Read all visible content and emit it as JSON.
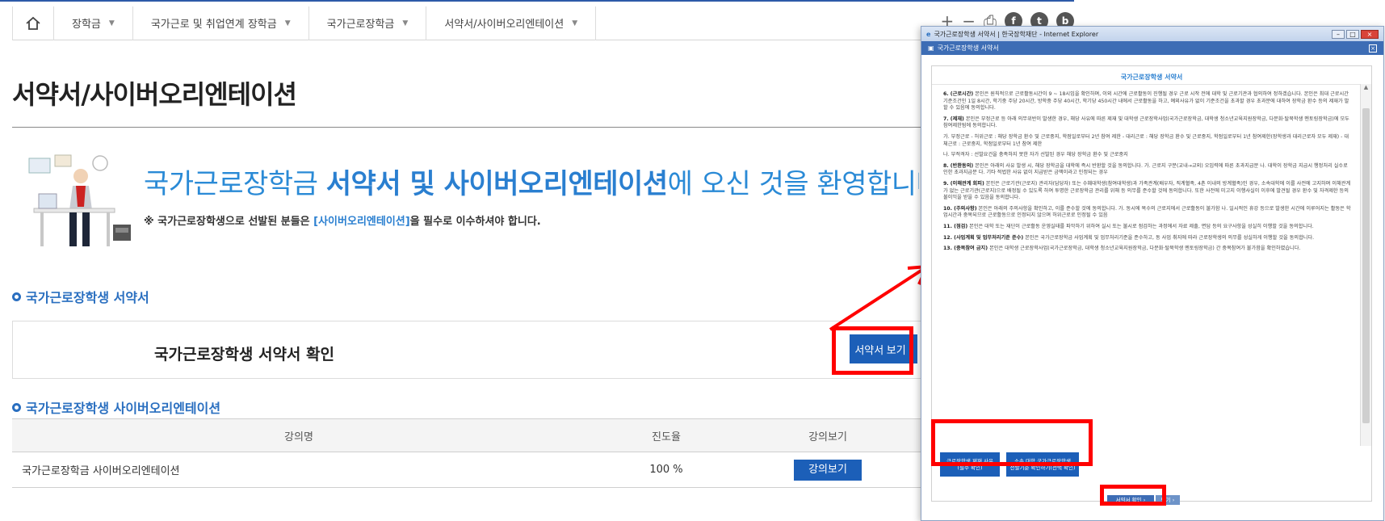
{
  "nav": {
    "items": [
      {
        "label": "장학금"
      },
      {
        "label": "국가근로 및 취업연계 장학금"
      },
      {
        "label": "국가근로장학금"
      },
      {
        "label": "서약서/사이버오리엔테이션"
      }
    ],
    "tools": {
      "plus": "+",
      "minus": "−",
      "print": "⎙",
      "facebook": "f",
      "twitter": "t",
      "blog": "b"
    }
  },
  "page": {
    "title": "서약서/사이버오리엔테이션"
  },
  "welcome": {
    "prefix": "국가근로장학금 ",
    "bold": "서약서 및 사이버오리엔테이션",
    "suffix": "에 오신 것을 환영합니다",
    "notice_prefix": "※ 국가근로장학생으로 선발된 분들은 ",
    "notice_link": "[사이버오리엔테이션]",
    "notice_suffix": "을 필수로 이수하셔야 합니다."
  },
  "oath": {
    "section_title": "국가근로장학생 서약서",
    "label": "국가근로장학생 서약서 확인",
    "button": "서약서 보기 ›"
  },
  "orientation": {
    "section_title": "국가근로장학생 사이버오리엔테이션",
    "headers": [
      "강의명",
      "진도율",
      "강의보기"
    ],
    "rows": [
      {
        "name": "국가근로장학금 사이버오리엔테이션",
        "progress": "100 %",
        "button": "강의보기"
      }
    ]
  },
  "popup": {
    "window_title": "국가근로장학생 서약서 | 한국장학재단 - Internet Explorer",
    "header": "국가근로장학생 서약서",
    "doc_title": "국가근로장학생 서약서",
    "clauses": [
      {
        "head": "6. (근로시간)",
        "body": "본인은 원칙적으로 근로활동시간이 9 ~ 18시임을 확인하며, 이외 시간에 근로활동이 진행될 경우 근로 시작 전에 대학 및 근로기관과 협의하여 정하겠습니다. 본인은 최대 근로시간 기준조건인 1일 8시간, 학기중 주당 20시간, 방학중 주당 40시간, 학기당 450시간 내에서 근로활동을 하고, 예외사유가 없이 기준조건을 초과할 경우 초과분에 대하여 장학금 환수 등의 제재가 발할 수 있음에 동의합니다."
      },
      {
        "head": "7. (제재)",
        "body": "본인은 부정근로 등 아래 의무위반이 발생한 경우, 해당 사유에 따른 제재 및 대학생 근로장학사업(국가근로장학금, 대학생 청소년교육지원장학금, 다문화·탈북학생 멘토링장학금)에 모두 참여제한됨에 동의합니다."
      },
      {
        "head": "",
        "body": "가. 부정근로 - 허위근로 : 해당 장학금 환수 및 근로중지, 학점일로부터 2년 참여 제한 - 대리근로 : 해당 장학금 환수 및 근로중지, 학점일로부터 1년 참여제한(장학생과 대리근로자 모두 제재) - 대체근로 : 근로중지, 학점일로부터 1년 참여 제한"
      },
      {
        "head": "",
        "body": "나. 부적격자 : 선발요건을 충족하지 못한 자가 선발된 경우 해당 장학금 환수 및 근로중지"
      },
      {
        "head": "8. (반환동의)",
        "body": "본인은 아래의 사유 발생 시, 해당 장학금을 대학에 즉시 반환할 것을 동의합니다. 가. 근로지 구분(교내→교외) 오입력에 따른 초과지급분 나. 대학이 장학금 지급시 행정처리 실수로 인한 초과지급분 다. 기타 적법한 사유 없이 지급받은 금액이라고 인정되는 경우"
      },
      {
        "head": "9. (이해관계 회피)",
        "body": "본인은 근로기관(근로지) 관리자(담당자) 또는 수혜대학생(참여대학생)과 가족관계(배우자, 직계혈족, 4촌 이내의 방계혈족)인 경우, 소속대학에 이를 사전에 고지하며 이해관계가 없는 근로기관(근로지)으로 배정될 수 있도록 하여 투명한 근로장학금 관리를 위해 등 의무를 준수할 것에 동의합니다. 또한 사전에 미고지 이행사실이 이후에 발견될 경우 환수 및 자격제한 등의 불이익을 받을 수 있음을 동의합니다."
      },
      {
        "head": "10. (주의사항)",
        "body": "본인은 아래의 주의사항을 확인하고, 이를 준수할 것에 동의합니다. 가. 동시에 복수의 근로지에서 근로활동이 불가함 나. 일시적인 휴강 등으로 발생한 시간에 이루어지는 활동은 학업시간과 중복되므로 근로활동으로 인정되지 않으며 허위근로로 인정될 수 있음"
      },
      {
        "head": "11. (점검)",
        "body": "본인은 대학 또는 재단이 근로활동 운영실태를 파악하기 위하여 실시 또는 불시로 점검하는 과정에서 자료 제출, 면담 등의 요구사항을 성실히 이행할 것을 동의합니다."
      },
      {
        "head": "12. (사업계획 및 업무처리기준 준수)",
        "body": "본인은 국가근로장학금 사업계획 및 업무처리기준을 준수하고, 동 사업 취지에 따라 근로장학생의 의무를 성실하게 이행할 것을 동의합니다."
      },
      {
        "head": "13. (중복참여 금지)",
        "body": "본인은 대학생 근로장학사업(국가근로장학금, 대학생 청소년교육지원장학금, 다문화·탈북학생 멘토링장학금) 간 중복참여가 불가함을 확인하였습니다."
      }
    ],
    "btn_reason_line1": "근로장학생 제재 사유",
    "btn_reason_line2": "(필수 확인)",
    "btn_criteria_line1": "소속 대학 국가근로장학생",
    "btn_criteria_line2": "선발기준 확인하기(선택 확인)",
    "confirm": "서약서 확인 ›",
    "close": "닫기 ›"
  },
  "colors": {
    "brand_blue": "#1c5fb8",
    "highlight_red": "#ff0000",
    "welcome_blue": "#2a8ad6"
  }
}
